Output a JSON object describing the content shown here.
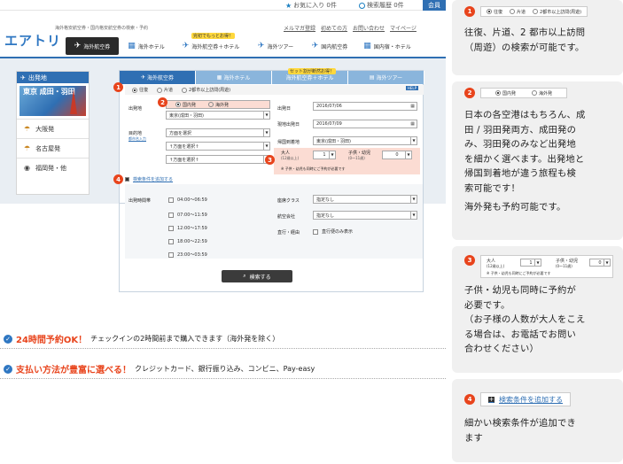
{
  "topbar": {
    "favorites": "お気に入り 0件",
    "history": "検索履歴 0件",
    "member": "会員"
  },
  "site": {
    "tagline": "海外格安航空券・国内格安航空券の検索・予約",
    "logo": "エアトリ",
    "nav": [
      "海外航空券",
      "海外ホテル",
      "海外航空券＋ホテル",
      "海外ツアー",
      "国内航空券",
      "国内宿・ホテル"
    ],
    "nav_highlight": "完初でもっとお得！",
    "links": [
      "メルマガ登録",
      "初めての方",
      "お問い合わせ",
      "マイページ"
    ]
  },
  "sidebar": {
    "title": "出発地",
    "banner": "東京 成田・羽田",
    "items": [
      {
        "label": "大阪発",
        "icon": "umbrella-icon"
      },
      {
        "label": "名古屋発",
        "icon": "umbrella-icon"
      },
      {
        "label": "福岡発・他",
        "icon": "eye-icon"
      }
    ]
  },
  "form": {
    "tabs": [
      "海外航空券",
      "海外ホテル",
      "海外航空券＋ホテル",
      "海外ツアー"
    ],
    "tab_highlight": "セット割が断然お得！",
    "trip_types": [
      "往復",
      "片道",
      "2都市以上訪問(周遊)"
    ],
    "help": "HELP",
    "origin_types": [
      "国内発",
      "海外発"
    ],
    "departure_label": "出発地",
    "departure_value": "東京(成田・羽田)",
    "destination_label": "目的地",
    "destination_sub": "都市名入力",
    "destination_values": [
      "方面を選択",
      "↑方面を選択↑",
      "↑方面を選択↑"
    ],
    "depart_date_label": "出発日",
    "depart_date": "2016/07/06",
    "local_date_label": "現地出発日",
    "local_date": "2016/07/09",
    "return_label": "帰国到着地",
    "return_value": "東京(成田・羽田)",
    "adult_label": "大人",
    "adult_sub": "(12歳以上)",
    "adult_value": "1",
    "child_label": "子供・幼児",
    "child_sub": "(0〜11歳)",
    "child_value": "0",
    "child_note": "※ 子供・幼児も同時にご予約が必要です",
    "add_conditions": "検索条件を追加する",
    "time_label": "出発時間帯",
    "time_options": [
      "04:00〜06:59",
      "07:00〜11:59",
      "12:00〜17:59",
      "18:00〜22:59",
      "23:00〜03:59"
    ],
    "class_label": "座席クラス",
    "class_value": "指定なし",
    "airline_label": "航空会社",
    "airline_value": "指定なし",
    "direct_label": "直行・経由",
    "direct_option": "直行便のみ表示",
    "search_button": "検索する"
  },
  "features": [
    {
      "head": "24時間予約OK！",
      "text": "チェックインの2時間前まで購入できます（海外発を除く）"
    },
    {
      "head": "支払い方法が豊富に選べる！",
      "text": "クレジットカード、銀行振り込み、コンビニ、Pay-easy"
    }
  ],
  "notes": [
    {
      "num": "1",
      "mini": [
        "往復",
        "片道",
        "2都市以上訪問(周遊)"
      ],
      "lines": [
        "往復、片道、2 都市以上訪問",
        "（周遊）の検索が可能です。"
      ]
    },
    {
      "num": "2",
      "mini": [
        "国内発",
        "海外発"
      ],
      "lines": [
        "日本の各空港はもちろん、成",
        "田 / 羽田発両方、成田発の",
        "み、羽田発のみなど出発地",
        "を細かく選べます。出発地と",
        "帰国到着地が違う旅程も検",
        "索可能です！",
        "海外発も予約可能です。"
      ]
    },
    {
      "num": "3",
      "mini_adult": "大人",
      "mini_adult_sub": "(12歳以上)",
      "mini_adult_value": "1",
      "mini_child": "子供・幼児",
      "mini_child_sub": "(0〜11歳)",
      "mini_child_value": "0",
      "mini_note": "※ 子供・幼児も同時にご予約が必要です",
      "lines": [
        "子供・幼児も同時に予約が",
        "必要です。",
        "（お子様の人数が大人をこえ",
        "る場合は、お電話でお問い",
        "合わせください）"
      ]
    },
    {
      "num": "4",
      "mini": "検索条件を追加する",
      "lines": [
        "細かい検索条件が追加でき",
        "ます"
      ]
    }
  ],
  "markers": [
    "1",
    "2",
    "3",
    "4"
  ]
}
